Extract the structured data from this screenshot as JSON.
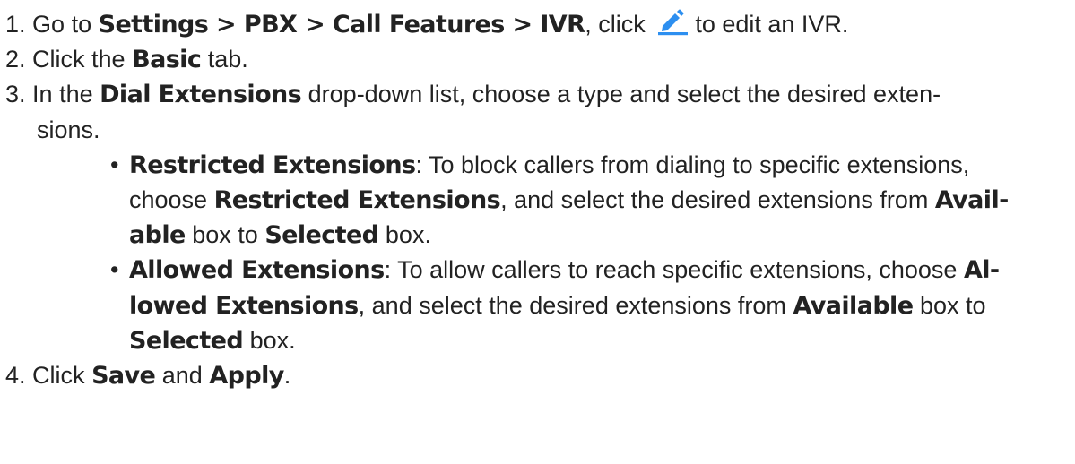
{
  "steps": [
    {
      "number": "1.",
      "go_to": "Go to",
      "path": "Settings > PBX > Call Features > IVR",
      "click_text": ", click",
      "edit_icon": "pencil-edit-icon",
      "edit_text": "to edit an IVR."
    },
    {
      "number": "2.",
      "pre": "Click the",
      "tab_name": "Basic",
      "post": "tab."
    },
    {
      "number": "3.",
      "pre": "In the",
      "field": "Dial Extensions",
      "post": "drop-down list, choose a type and select the desired exten-",
      "post_cont": "sions.",
      "bullets": [
        {
          "term": "Restricted Extensions",
          "seg1": ": To block callers from dialing to specific extensions,",
          "seg2": "choose",
          "term2": "Restricted Extensions",
          "seg3": ", and select the desired extensions from",
          "avail_part1": "Avail-",
          "avail_part2": "able",
          "seg4": "box to",
          "selected": "Selected",
          "seg5": "box."
        },
        {
          "term": "Allowed Extensions",
          "seg1": ": To allow callers to reach specific extensions, choose",
          "term2_part1": "Al-",
          "term2_part2": "lowed Extensions",
          "seg2": ", and select the desired extensions from",
          "available": "Available",
          "seg3": "box to",
          "selected": "Selected",
          "seg4": "box."
        }
      ]
    },
    {
      "number": "4.",
      "pre": "Click",
      "save": "Save",
      "and": "and",
      "apply": "Apply",
      "post": "."
    }
  ],
  "colors": {
    "text": "#222222",
    "icon_blue": "#2d8ff0"
  }
}
